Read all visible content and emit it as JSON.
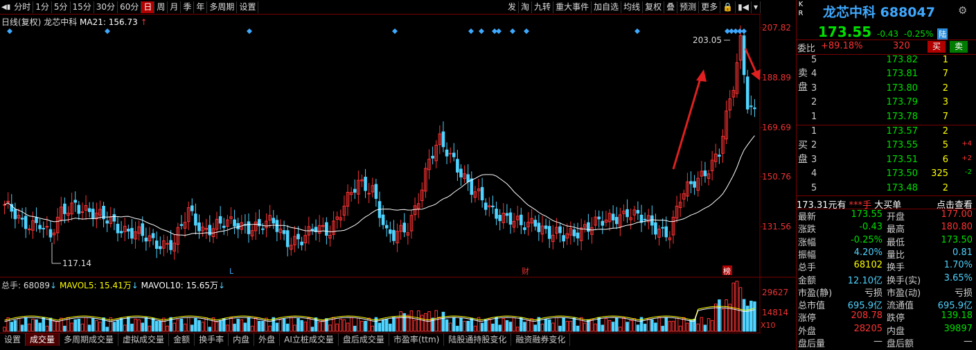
{
  "toolbar": {
    "left_items": [
      "分时",
      "1分",
      "5分",
      "15分",
      "30分",
      "60分",
      "日",
      "周",
      "月",
      "季",
      "年",
      "多周期",
      "设置"
    ],
    "active": "日",
    "right_items": [
      "发",
      "淘",
      "九转",
      "重大事件",
      "加自选",
      "均线",
      "复权",
      "叠",
      "预测",
      "更多"
    ]
  },
  "chart_header": {
    "title": "日线(复权)",
    "stock": "龙芯中科",
    "ma_label": "MA21: 156.73",
    "ma_arrow": "↑"
  },
  "price_axis": [
    "207.82",
    "188.89",
    "169.69",
    "150.76",
    "131.56"
  ],
  "price_annotations": {
    "high": "203.05",
    "low": "117.14"
  },
  "markers": {
    "l": "L",
    "cai": "财",
    "bang": "榜"
  },
  "volume_header": {
    "label": "总手: ",
    "total": "68089",
    "mavol5_label": "MAVOL5: 15.41万",
    "mavol10_label": "MAVOL10: 15.65万"
  },
  "volume_axis": [
    "29627",
    "14814"
  ],
  "volume_unit": "X10",
  "bottom_tabs": [
    "设置",
    "成交量",
    "多周期成交量",
    "虚拟成交量",
    "金额",
    "换手率",
    "内盘",
    "外盘",
    "AI立桩成交量",
    "盘后成交量",
    "市盈率(ttm)",
    "陆股通持股变化",
    "融资融券变化"
  ],
  "bottom_active": "成交量",
  "colors": {
    "up": "#ff3333",
    "down": "#4fd3ff",
    "ma": "#ffffff",
    "accent": "#7a0000"
  },
  "chart_data": {
    "type": "candlestick",
    "title": "龙芯中科 日线(复权)",
    "ylim": [
      117.14,
      207.82
    ],
    "ma21_last": 156.73,
    "period_high": 203.05,
    "period_low": 117.14
  },
  "quote": {
    "kr": [
      "K",
      "R"
    ],
    "name": "龙芯中科",
    "code": "688047",
    "price": "173.55",
    "change": "-0.43",
    "change_pct": "-0.25%",
    "market_tag": "陆",
    "weibi_label": "委比",
    "weibi_value": "+89.18%",
    "weicha": "320",
    "buy_btn": "买",
    "sell_btn": "卖",
    "sell_side_label": [
      "卖",
      "盘"
    ],
    "buy_side_label": [
      "买",
      "盘"
    ],
    "asks": [
      {
        "level": "5",
        "price": "173.82",
        "vol": "1",
        "chg": ""
      },
      {
        "level": "4",
        "price": "173.81",
        "vol": "7",
        "chg": ""
      },
      {
        "level": "3",
        "price": "173.80",
        "vol": "2",
        "chg": ""
      },
      {
        "level": "2",
        "price": "173.79",
        "vol": "3",
        "chg": ""
      },
      {
        "level": "1",
        "price": "173.78",
        "vol": "7",
        "chg": ""
      }
    ],
    "bids": [
      {
        "level": "1",
        "price": "173.57",
        "vol": "2",
        "chg": ""
      },
      {
        "level": "2",
        "price": "173.55",
        "vol": "5",
        "chg": "+4"
      },
      {
        "level": "3",
        "price": "173.51",
        "vol": "6",
        "chg": "+2"
      },
      {
        "level": "4",
        "price": "173.50",
        "vol": "325",
        "chg": "-2"
      },
      {
        "level": "5",
        "price": "173.48",
        "vol": "2",
        "chg": ""
      }
    ],
    "big_order": {
      "amount": "173.31元有",
      "star": "***手",
      "label": "大买单",
      "link": "点击查看"
    },
    "stats": [
      {
        "l1": "最新",
        "v1": "173.55",
        "c1": "g",
        "l2": "开盘",
        "v2": "177.00",
        "c2": "r"
      },
      {
        "l1": "涨跌",
        "v1": "-0.43",
        "c1": "g",
        "l2": "最高",
        "v2": "180.80",
        "c2": "r"
      },
      {
        "l1": "涨幅",
        "v1": "-0.25%",
        "c1": "g",
        "l2": "最低",
        "v2": "173.50",
        "c2": "g"
      },
      {
        "l1": "振幅",
        "v1": "4.20%",
        "c1": "c",
        "l2": "量比",
        "v2": "0.81",
        "c2": "c"
      },
      {
        "l1": "总手",
        "v1": "68102",
        "c1": "y",
        "l2": "换手",
        "v2": "1.70%",
        "c2": "c"
      },
      {
        "l1": "金额",
        "v1": "12.10亿",
        "c1": "c",
        "l2": "换手(实)",
        "v2": "3.65%",
        "c2": "c"
      },
      {
        "l1": "市盈(静)",
        "v1": "亏损",
        "c1": "w",
        "l2": "市盈(动)",
        "v2": "亏损",
        "c2": "w"
      },
      {
        "l1": "总市值",
        "v1": "695.9亿",
        "c1": "c",
        "l2": "流通值",
        "v2": "695.9亿",
        "c2": "c"
      },
      {
        "l1": "涨停",
        "v1": "208.78",
        "c1": "r",
        "l2": "跌停",
        "v2": "139.18",
        "c2": "g"
      },
      {
        "l1": "外盘",
        "v1": "28205",
        "c1": "r",
        "l2": "内盘",
        "v2": "39897",
        "c2": "g"
      },
      {
        "l1": "盘后量",
        "v1": "—",
        "c1": "w",
        "l2": "盘后额",
        "v2": "—",
        "c2": "w"
      }
    ]
  }
}
